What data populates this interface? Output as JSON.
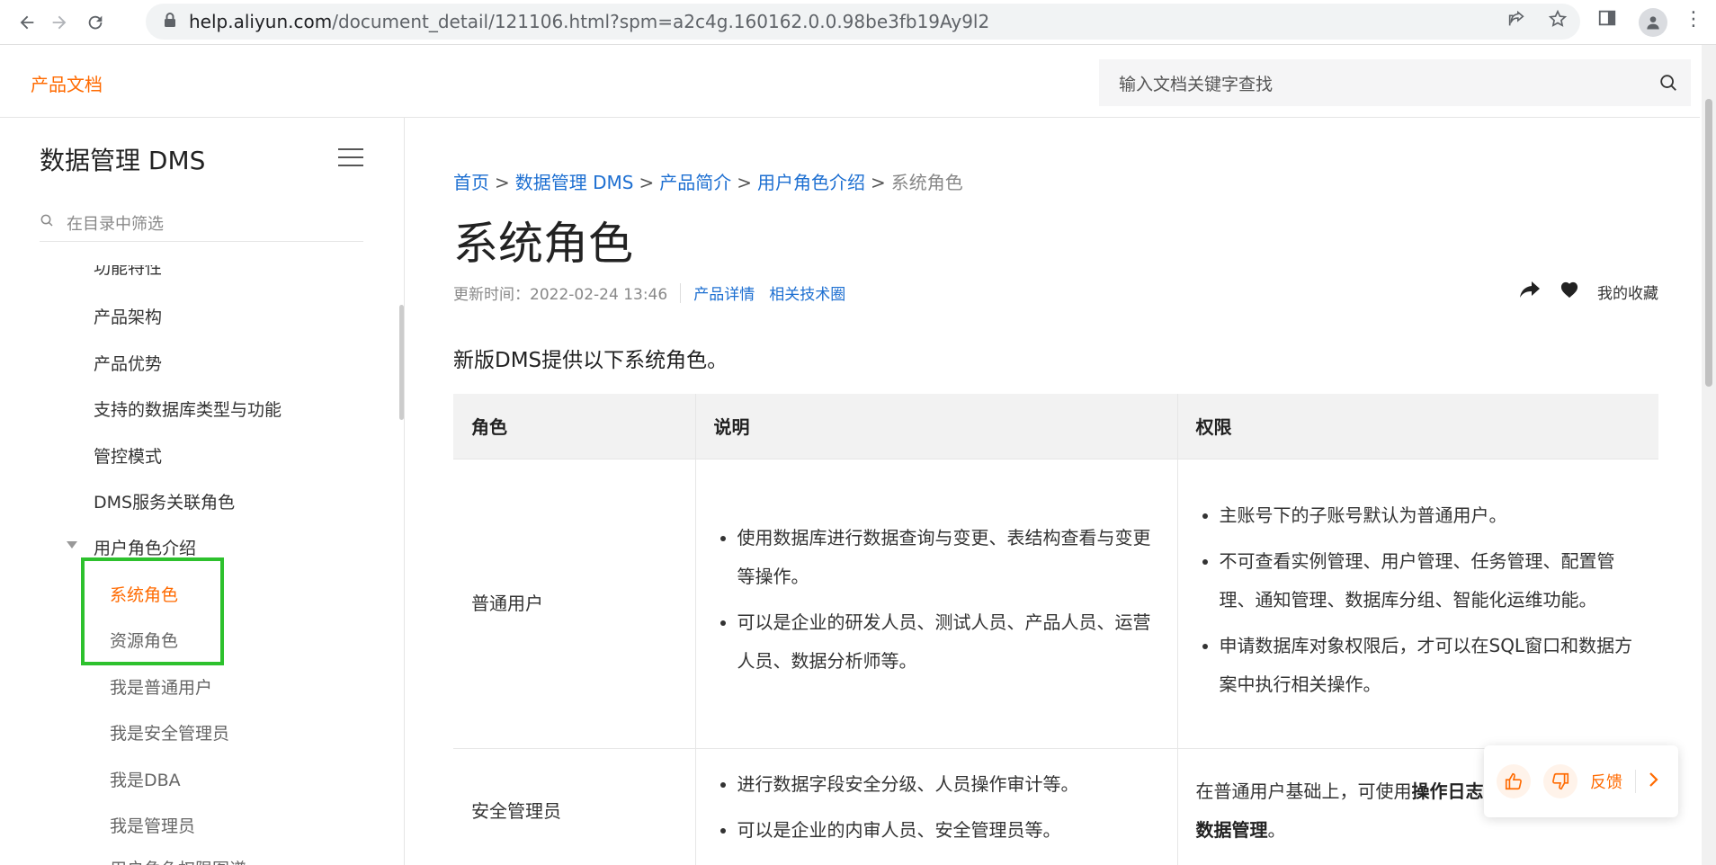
{
  "browser": {
    "url_host": "help.aliyun.com",
    "url_path": "/document_detail/121106.html?spm=a2c4g.160162.0.0.98be3fb19Ay9l2"
  },
  "header": {
    "brand": "产品文档",
    "search_placeholder": "输入文档关键字查找"
  },
  "sidebar": {
    "title": "数据管理 DMS",
    "filter_placeholder": "在目录中筛选",
    "items": [
      {
        "label": "功能特性"
      },
      {
        "label": "产品架构"
      },
      {
        "label": "产品优势"
      },
      {
        "label": "支持的数据库类型与功能"
      },
      {
        "label": "管控模式"
      },
      {
        "label": "DMS服务关联角色"
      },
      {
        "label": "用户角色介绍"
      },
      {
        "label": "系统角色"
      },
      {
        "label": "资源角色"
      },
      {
        "label": "我是普通用户"
      },
      {
        "label": "我是安全管理员"
      },
      {
        "label": "我是DBA"
      },
      {
        "label": "我是管理员"
      },
      {
        "label": "用户角色权限图谱"
      }
    ]
  },
  "main": {
    "breadcrumb": [
      "首页",
      "数据管理 DMS",
      "产品简介",
      "用户角色介绍",
      "系统角色"
    ],
    "breadcrumb_sep": ">",
    "title": "系统角色",
    "updated": "更新时间：2022-02-24 13:46",
    "links": [
      "产品详情",
      "相关技术圈"
    ],
    "favorite": "我的收藏",
    "intro": "新版DMS提供以下系统角色。",
    "table": {
      "headers": [
        "角色",
        "说明",
        "权限"
      ],
      "rows": [
        {
          "role": "普通用户",
          "desc": [
            "使用数据库进行数据查询与变更、表结构查看与变更等操作。",
            "可以是企业的研发人员、测试人员、产品人员、运营人员、数据分析师等。"
          ],
          "perm": [
            "主账号下的子账号默认为普通用户。",
            "不可查看实例管理、用户管理、任务管理、配置管理、通知管理、数据库分组、智能化运维功能。",
            "申请数据库对象权限后，才可以在SQL窗口和数据方案中执行相关操作。"
          ]
        },
        {
          "role": "安全管理员",
          "desc": [
            "进行数据字段安全分级、人员操作审计等。",
            "可以是企业的内审人员、安全管理员等。"
          ],
          "perm_prefix": "在普通用户基础上，可使用",
          "perm_bold": "操作日志、安全规则、敏感数据管理",
          "perm_suffix": "。"
        }
      ]
    }
  },
  "feedback": {
    "label": "反馈"
  },
  "colors": {
    "accent": "#ff6a00",
    "link": "#1d6fd1",
    "highlight": "#2dc12d"
  }
}
